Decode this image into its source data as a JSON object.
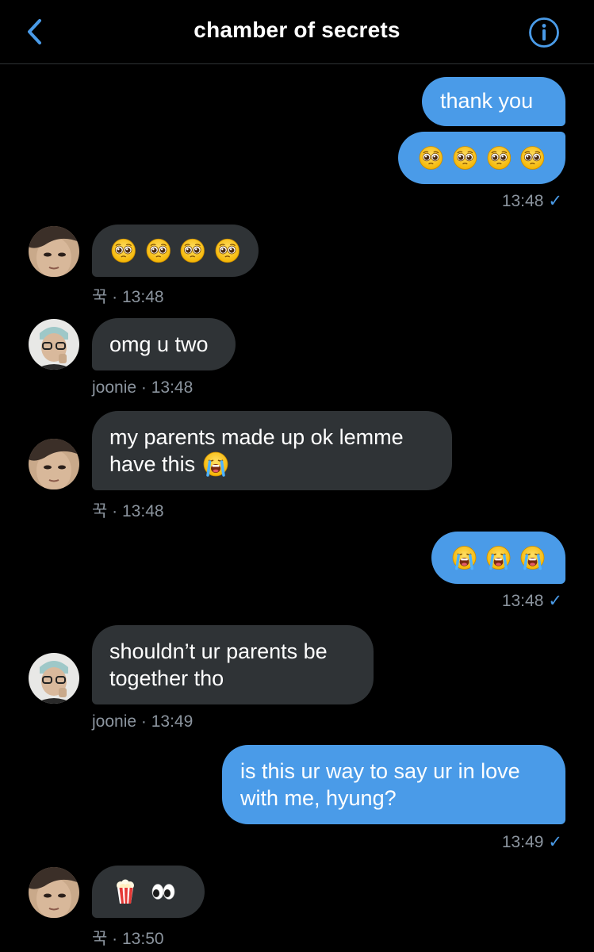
{
  "header": {
    "title": "chamber of secrets"
  },
  "messages": {
    "m1": {
      "text": "thank you",
      "time": "13:48"
    },
    "m2": {
      "emoji": "pleading-face",
      "count": 4
    },
    "m3": {
      "emoji": "pleading-face",
      "count": 4,
      "sender": "꾹",
      "time": "13:48"
    },
    "m4": {
      "text": "omg u two",
      "sender": "joonie",
      "time": "13:48"
    },
    "m5": {
      "line1": "my parents made up ok lemme",
      "line2": "have this",
      "emoji": "loudly-crying-face",
      "sender": "꾹",
      "time": "13:48"
    },
    "m6": {
      "emoji": "loudly-crying-face",
      "count": 3,
      "time": "13:48"
    },
    "m7": {
      "line1": "shouldn’t ur parents be",
      "line2": "together tho",
      "sender": "joonie",
      "time": "13:49"
    },
    "m8": {
      "line1": "is this ur way to say ur in love",
      "line2": "with me, hyung?",
      "time": "13:49"
    },
    "m9": {
      "emojis": [
        "popcorn",
        "eyes"
      ],
      "sender": "꾹",
      "time": "13:50"
    }
  },
  "meta_separator": " · ",
  "read_check": "✓",
  "colors": {
    "outgoing": "#4a9be8",
    "incoming": "#2f3336",
    "accent": "#4a9be8",
    "meta": "#8b949e"
  }
}
